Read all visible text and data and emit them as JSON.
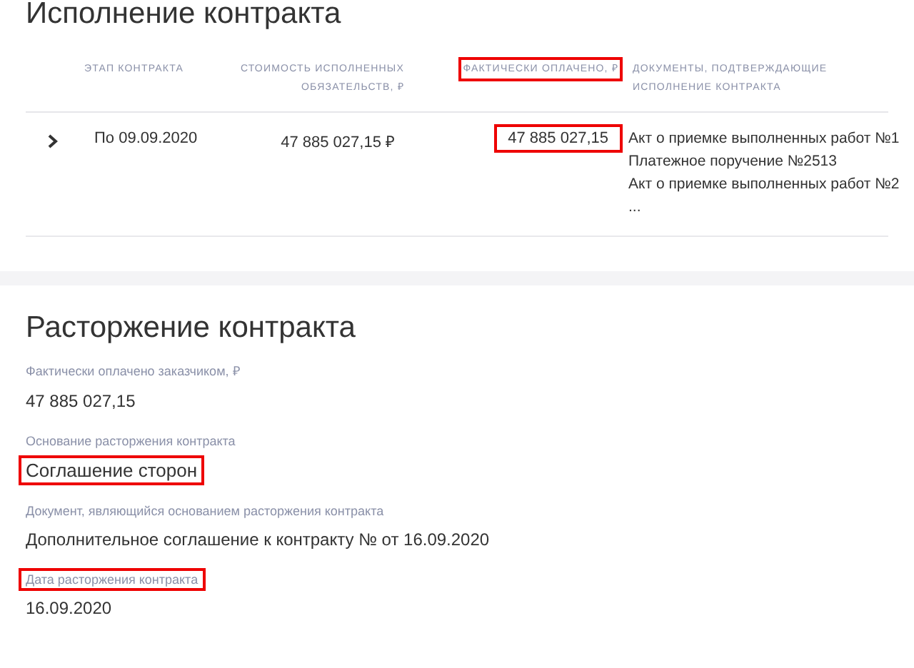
{
  "execution": {
    "title": "Исполнение контракта",
    "columns": [
      {
        "label": "ЭТАП КОНТРАКТА",
        "highlighted": false
      },
      {
        "label": "СТОИМОСТЬ ИСПОЛНЕННЫХ ОБЯЗАТЕЛЬСТВ, ₽",
        "highlighted": false
      },
      {
        "label": "ФАКТИЧЕСКИ ОПЛАЧЕНО, ₽",
        "highlighted": true
      },
      {
        "label": "ДОКУМЕНТЫ, ПОДТВЕРЖДАЮЩИЕ ИСПОЛНЕНИЕ КОНТРАКТА",
        "highlighted": false
      }
    ],
    "rows": [
      {
        "expanded": false,
        "stage": "По 09.09.2020",
        "cost": "47 885 027,15 ₽",
        "paid": "47 885 027,15",
        "paid_highlighted": true,
        "documents": [
          "Акт о приемке выполненных работ №1",
          "Платежное поручение №2513",
          "Акт о приемке выполненных работ №2",
          "..."
        ]
      }
    ]
  },
  "termination": {
    "title": "Расторжение контракта",
    "fields": [
      {
        "label": "Фактически оплачено заказчиком, ₽",
        "value": "47 885 027,15",
        "label_highlighted": false,
        "value_highlighted": false
      },
      {
        "label": "Основание расторжения контракта",
        "value": "Соглашение сторон",
        "label_highlighted": false,
        "value_highlighted": true
      },
      {
        "label": "Документ, являющийся основанием расторжения контракта",
        "value": "Дополнительное соглашение к контракту № от 16.09.2020",
        "label_highlighted": false,
        "value_highlighted": false
      },
      {
        "label": "Дата расторжения контракта",
        "value": "16.09.2020",
        "label_highlighted": true,
        "value_highlighted": false
      }
    ]
  }
}
